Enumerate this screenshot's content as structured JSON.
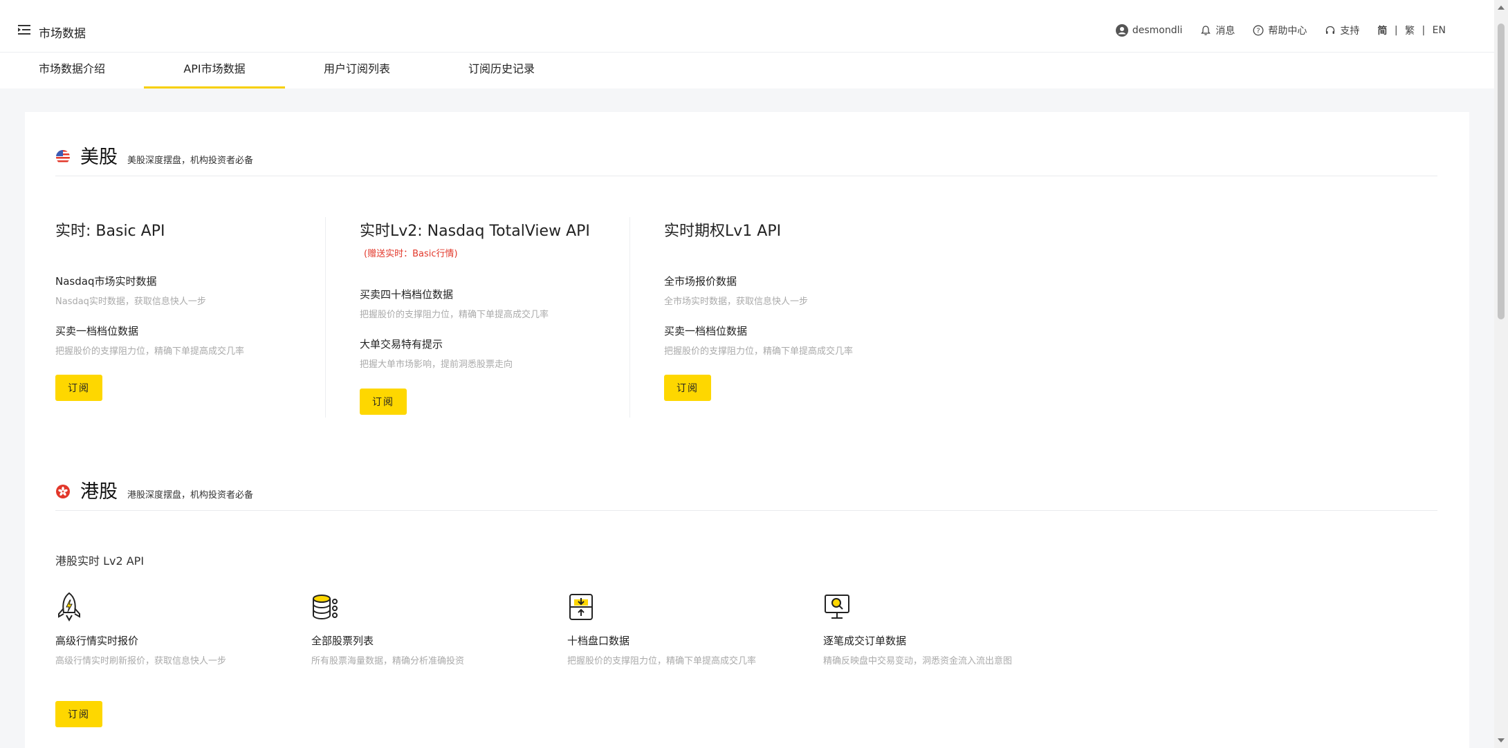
{
  "header": {
    "title": "市场数据",
    "user": "desmondli",
    "messages": "消息",
    "help": "帮助中心",
    "support": "支持",
    "lang_simplified": "简",
    "lang_sep1": " | ",
    "lang_traditional": "繁",
    "lang_sep2": " | ",
    "lang_en": "EN"
  },
  "tabs": [
    {
      "label": "市场数据介绍"
    },
    {
      "label": "API市场数据"
    },
    {
      "label": "用户订阅列表"
    },
    {
      "label": "订阅历史记录"
    }
  ],
  "us": {
    "title": "美股",
    "desc": "美股深度摆盘，机构投资者必备",
    "cols": [
      {
        "title": "实时: Basic API",
        "features": [
          {
            "title": "Nasdaq市场实时数据",
            "desc": "Nasdaq实时数据，获取信息快人一步"
          },
          {
            "title": "买卖一档档位数据",
            "desc": "把握股价的支撑阻力位，精确下单提高成交几率"
          }
        ],
        "button": "订阅"
      },
      {
        "title": "实时Lv2: Nasdaq TotalView API",
        "bonus": "(赠送实时：Basic行情)",
        "features": [
          {
            "title": "买卖四十档档位数据",
            "desc": "把握股价的支撑阻力位，精确下单提高成交几率"
          },
          {
            "title": "大单交易特有提示",
            "desc": "把握大单市场影响，提前洞悉股票走向"
          }
        ],
        "button": "订阅"
      },
      {
        "title": "实时期权Lv1 API",
        "features": [
          {
            "title": "全市场报价数据",
            "desc": "全市场实时数据，获取信息快人一步"
          },
          {
            "title": "买卖一档档位数据",
            "desc": "把握股价的支撑阻力位，精确下单提高成交几率"
          }
        ],
        "button": "订阅"
      }
    ]
  },
  "hk": {
    "title": "港股",
    "desc": "港股深度摆盘，机构投资者必备",
    "api_title": "港股实时 Lv2 API",
    "features": [
      {
        "icon": "rocket-icon",
        "title": "高级行情实时报价",
        "desc": "高级行情实时刷新报价，获取信息快人一步"
      },
      {
        "icon": "database-icon",
        "title": "全部股票列表",
        "desc": "所有股票海量数据，精确分析准确投资"
      },
      {
        "icon": "order-book-icon",
        "title": "十档盘口数据",
        "desc": "把握股价的支撑阻力位，精确下单提高成交几率"
      },
      {
        "icon": "monitor-search-icon",
        "title": "逐笔成交订单数据",
        "desc": "精确反映盘中交易变动，洞悉资金流入流出意图"
      }
    ],
    "button": "订阅"
  },
  "colors": {
    "accent": "#fed700",
    "bonus_red": "#e2372a",
    "tab_underline": "#f7cf00"
  }
}
